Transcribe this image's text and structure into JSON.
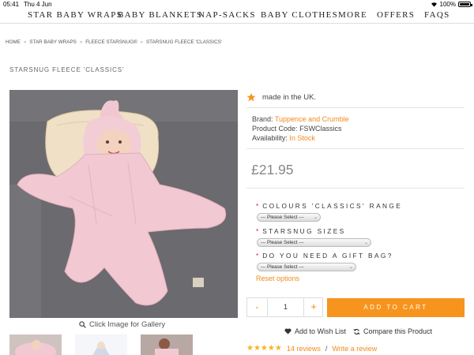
{
  "status_bar": {
    "time": "05:41",
    "date": "Thu 4 Jun",
    "battery": "100%"
  },
  "nav": {
    "items": [
      "STAR BABY WRAPS",
      "BABY BLANKETS",
      "NAP-SACKS",
      "BABY CLOTHES",
      "MORE",
      "OFFERS",
      "FAQS"
    ]
  },
  "breadcrumb": [
    "HOME",
    "STAR BABY WRAPS",
    "FLEECE STARSNUG®",
    "STARSNUG FLEECE 'CLASSICS'"
  ],
  "product": {
    "title": "STARSNUG FLEECE 'CLASSICS'",
    "made_in": "made in the UK.",
    "brand_label": "Brand:",
    "brand": "Tuppence and Crumble",
    "code_label": "Product Code:",
    "code": "FSWClassics",
    "availability_label": "Availability:",
    "availability": "In Stock",
    "price": "£21.95"
  },
  "gallery": {
    "link_text": "Click Image for Gallery"
  },
  "options": {
    "colours_label": "COLOURS 'CLASSICS' RANGE",
    "colours_value": "--- Please Select ---",
    "sizes_label": "STARSNUG SIZES",
    "sizes_value": "--- Please Select ---",
    "giftbag_label": "DO YOU NEED A GIFT BAG?",
    "giftbag_value": "--- Please Select ---",
    "required_mark": "*",
    "reset": "Reset options"
  },
  "cart": {
    "minus": "-",
    "quantity": "1",
    "plus": "+",
    "add_label": "ADD TO CART"
  },
  "actions": {
    "wishlist": "Add to Wish List",
    "compare": "Compare this Product"
  },
  "reviews": {
    "stars": "★★★★★",
    "count_text": "14 reviews",
    "separator": "/",
    "write": "Write a review"
  },
  "colors": {
    "accent": "#f7941d",
    "link": "#f08a1c",
    "required": "#e02020"
  }
}
